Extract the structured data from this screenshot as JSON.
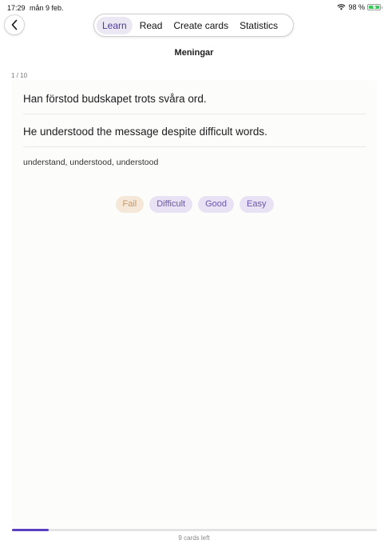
{
  "status_bar": {
    "time": "17:29",
    "date": "mån 9 feb.",
    "battery": "98 %",
    "icons": [
      "wifi-icon",
      "battery-charging-icon"
    ]
  },
  "nav": {
    "back_icon": "chevron-left-icon",
    "tabs": [
      {
        "label": "Learn",
        "active": true
      },
      {
        "label": "Read",
        "active": false
      },
      {
        "label": "Create cards",
        "active": false
      },
      {
        "label": "Statistics",
        "active": false
      }
    ]
  },
  "title": "Meningar",
  "card": {
    "counter": "1 / 10",
    "sentence_sv": "Han förstod budskapet trots svåra ord.",
    "sentence_en": "He understood the message despite difficult words.",
    "word_forms": "understand, understood, understood"
  },
  "answers": {
    "fail": "Fail",
    "difficult": "Difficult",
    "good": "Good",
    "easy": "Easy"
  },
  "progress": {
    "fraction": 0.1,
    "cards_left": "9 cards left"
  },
  "colors": {
    "accent": "#5a3fc0",
    "fail_bg": "#f5e8d8",
    "fail_text": "#c4986a",
    "answer_bg": "#e9e2f4",
    "answer_text": "#6b55a8",
    "battery": "#35c759"
  }
}
